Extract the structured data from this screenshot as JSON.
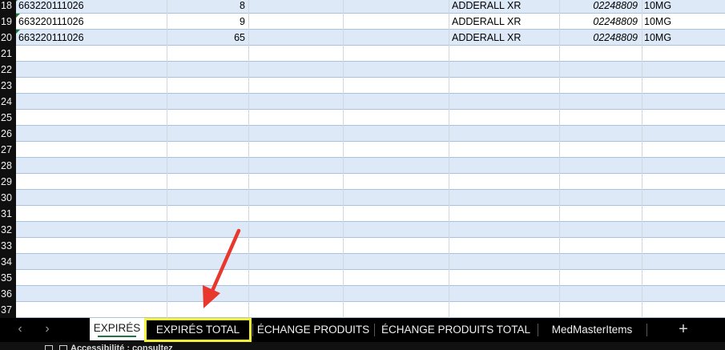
{
  "rows": [
    {
      "num": "18",
      "a": "663220111026",
      "b": "8",
      "e": "ADDERALL XR",
      "f": "02248809",
      "g": "10MG",
      "flag": true
    },
    {
      "num": "19",
      "a": "663220111026",
      "b": "9",
      "e": "ADDERALL XR",
      "f": "02248809",
      "g": "10MG",
      "flag": true
    },
    {
      "num": "20",
      "a": "663220111026",
      "b": "65",
      "e": "ADDERALL XR",
      "f": "02248809",
      "g": "10MG",
      "flag": true
    },
    {
      "num": "21"
    },
    {
      "num": "22"
    },
    {
      "num": "23"
    },
    {
      "num": "24"
    },
    {
      "num": "25"
    },
    {
      "num": "26"
    },
    {
      "num": "27"
    },
    {
      "num": "28"
    },
    {
      "num": "29"
    },
    {
      "num": "30"
    },
    {
      "num": "31"
    },
    {
      "num": "32"
    },
    {
      "num": "33"
    },
    {
      "num": "34"
    },
    {
      "num": "35"
    },
    {
      "num": "36"
    },
    {
      "num": "37"
    }
  ],
  "tabs": {
    "prev_icon": "chevron-left-icon",
    "next_icon": "chevron-right-icon",
    "items": [
      {
        "label": "EXPIRÉS",
        "active": true
      },
      {
        "label": "EXPIRÉS TOTAL",
        "highlighted": true
      },
      {
        "label": "ÉCHANGE PRODUITS"
      },
      {
        "label": "ÉCHANGE PRODUITS TOTAL"
      },
      {
        "label": "MedMasterItems"
      }
    ],
    "add_label": "+"
  },
  "status": {
    "text": "Accessibilité : consultez"
  },
  "colors": {
    "band": "#dde9f6",
    "grid_line": "#a8c2df",
    "highlight": "#f5f53a",
    "arrow": "#e8382e",
    "active_underline": "#217346"
  }
}
